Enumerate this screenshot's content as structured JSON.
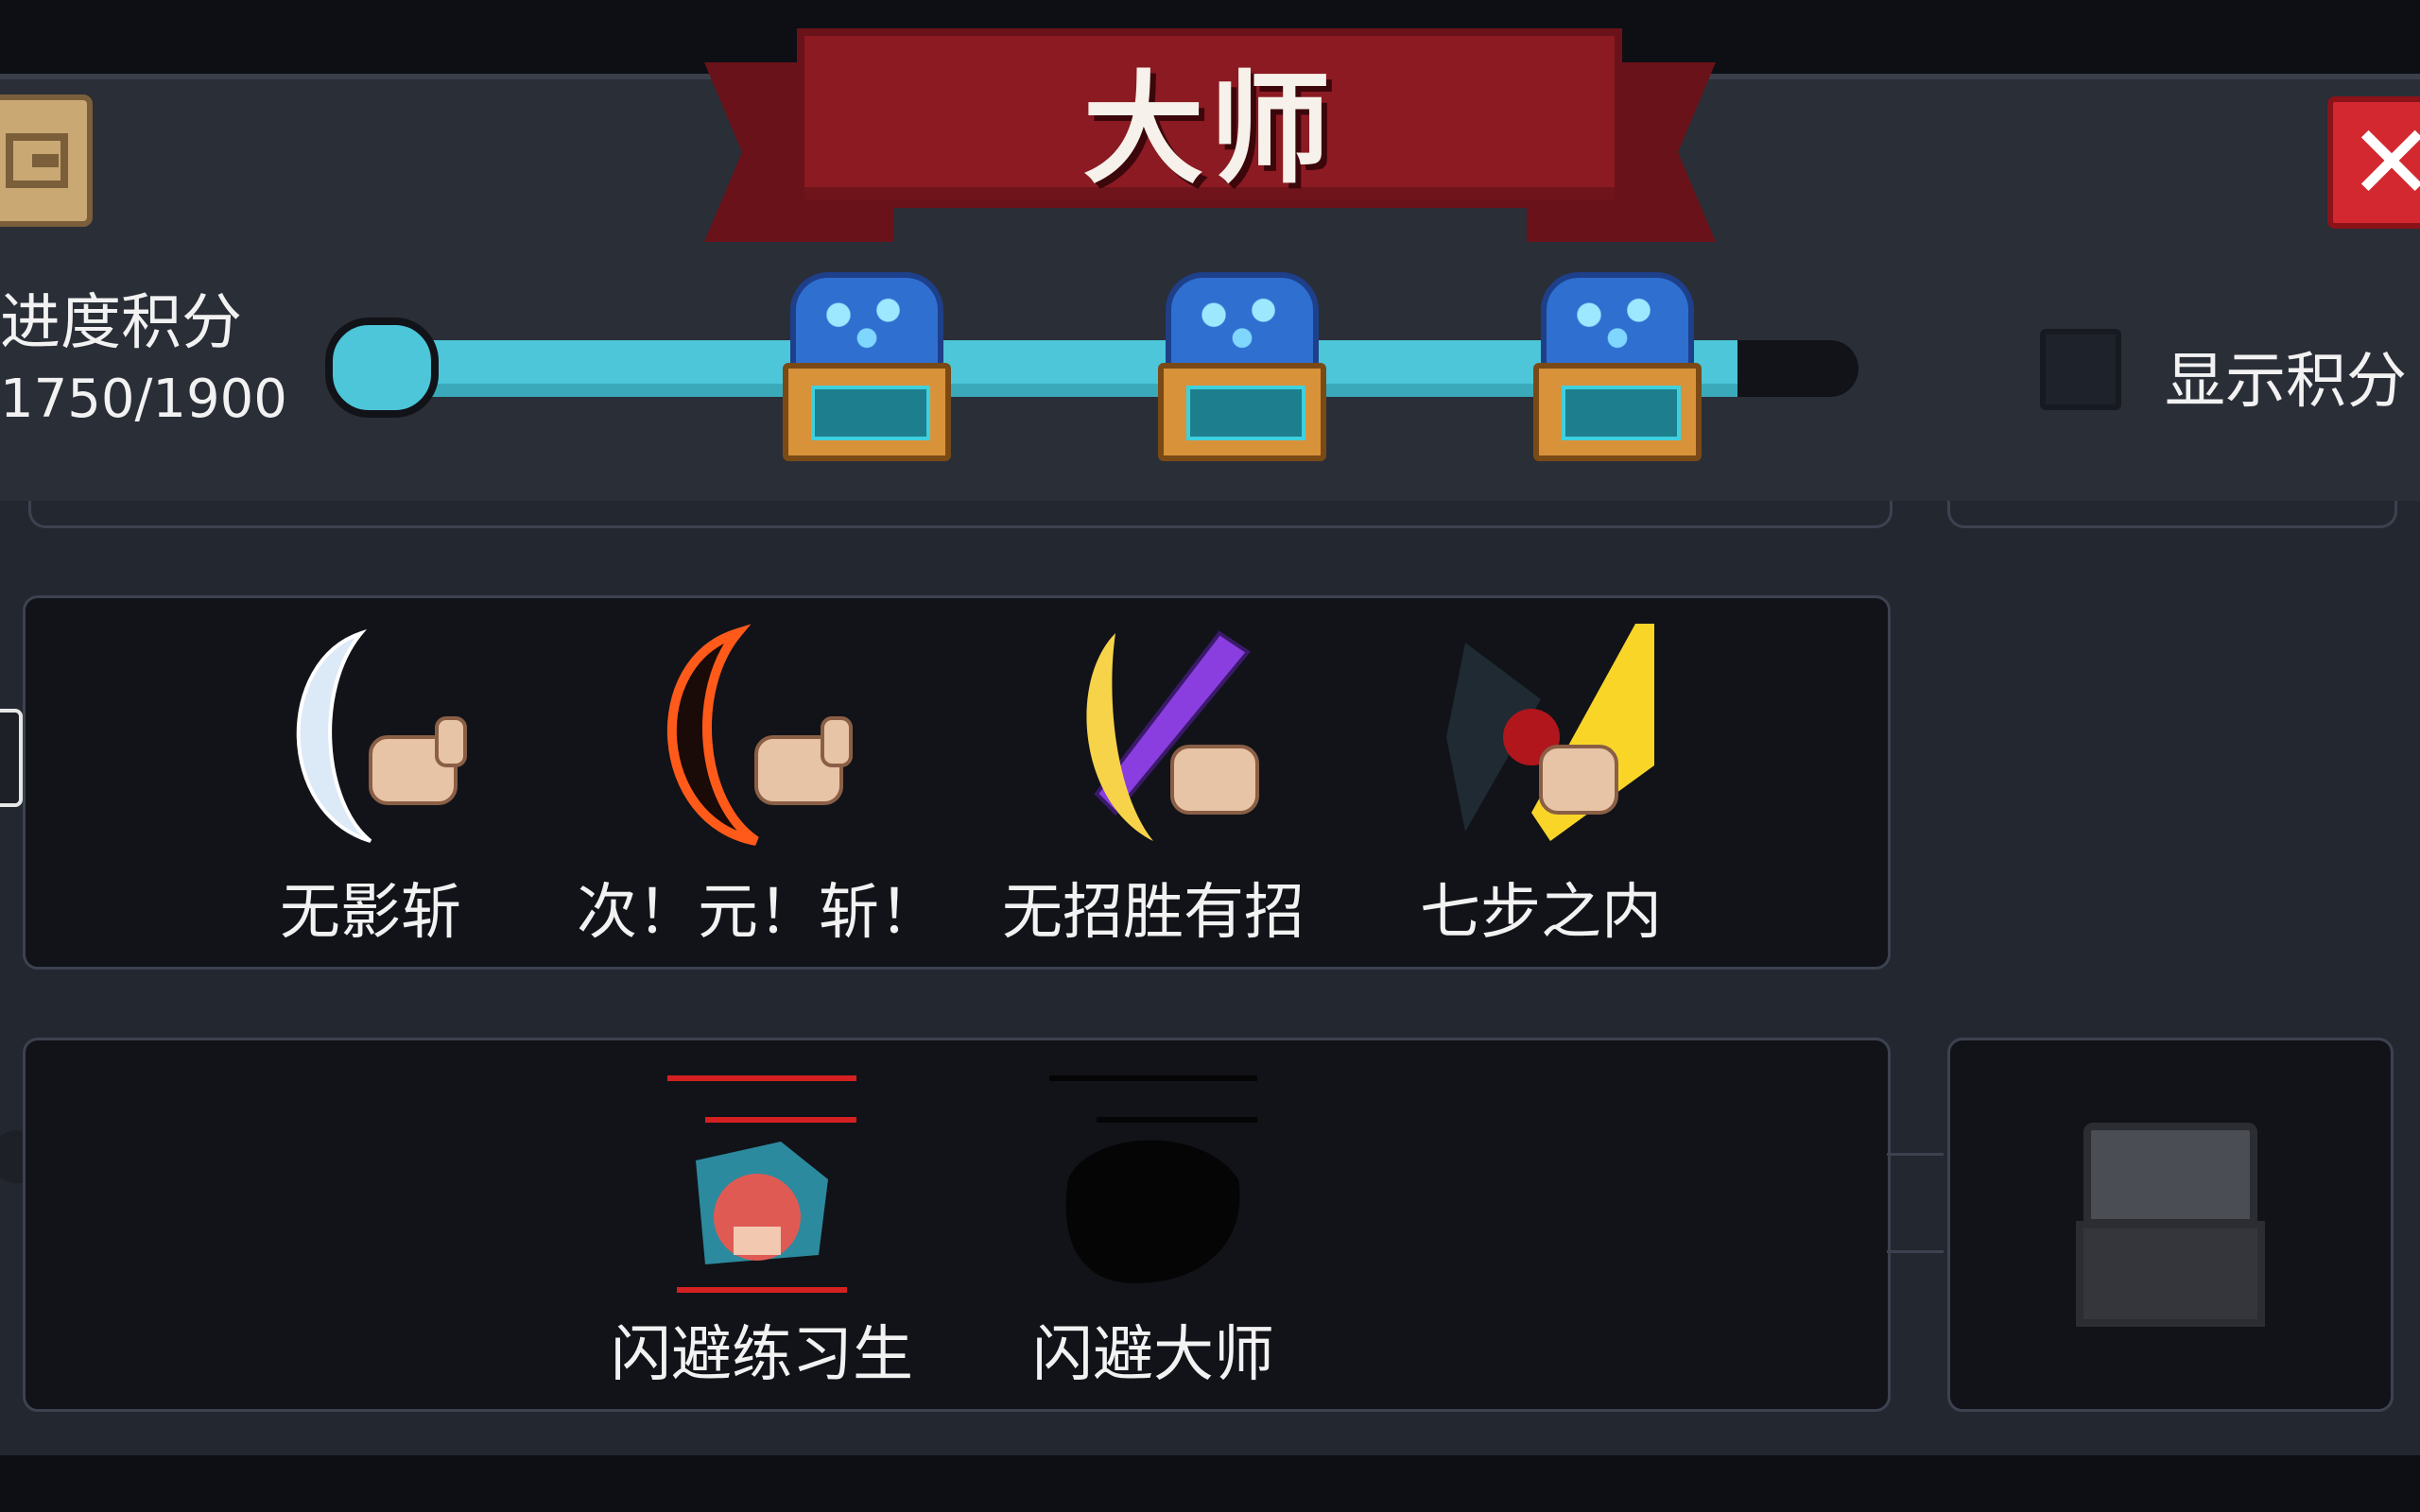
{
  "header": {
    "title": "大师",
    "close_glyph": "✕"
  },
  "progress": {
    "label": "进度积分",
    "value": "1750/1900",
    "fraction": 0.921,
    "milestones": [
      "gem-chest",
      "gem-chest",
      "gem-chest"
    ]
  },
  "show_points": {
    "label": "显示积分",
    "checked": false
  },
  "skills_row_1": [
    {
      "name": "无影斩",
      "icon": "crescent-slash-icon"
    },
    {
      "name": "次！元！斩！",
      "icon": "dimension-slash-icon"
    },
    {
      "name": "无招胜有招",
      "icon": "purple-sword-slash-icon"
    },
    {
      "name": "七步之内",
      "icon": "golden-blade-blood-icon"
    }
  ],
  "skills_row_2": [
    {
      "name": "闪避练习生",
      "icon": "dodge-trainee-icon"
    },
    {
      "name": "闪避大师",
      "icon": "dodge-master-silhouette-icon"
    }
  ],
  "colors": {
    "ribbon": "#8c1a22",
    "progress_fill": "#4cc6d8",
    "close": "#d42830"
  }
}
